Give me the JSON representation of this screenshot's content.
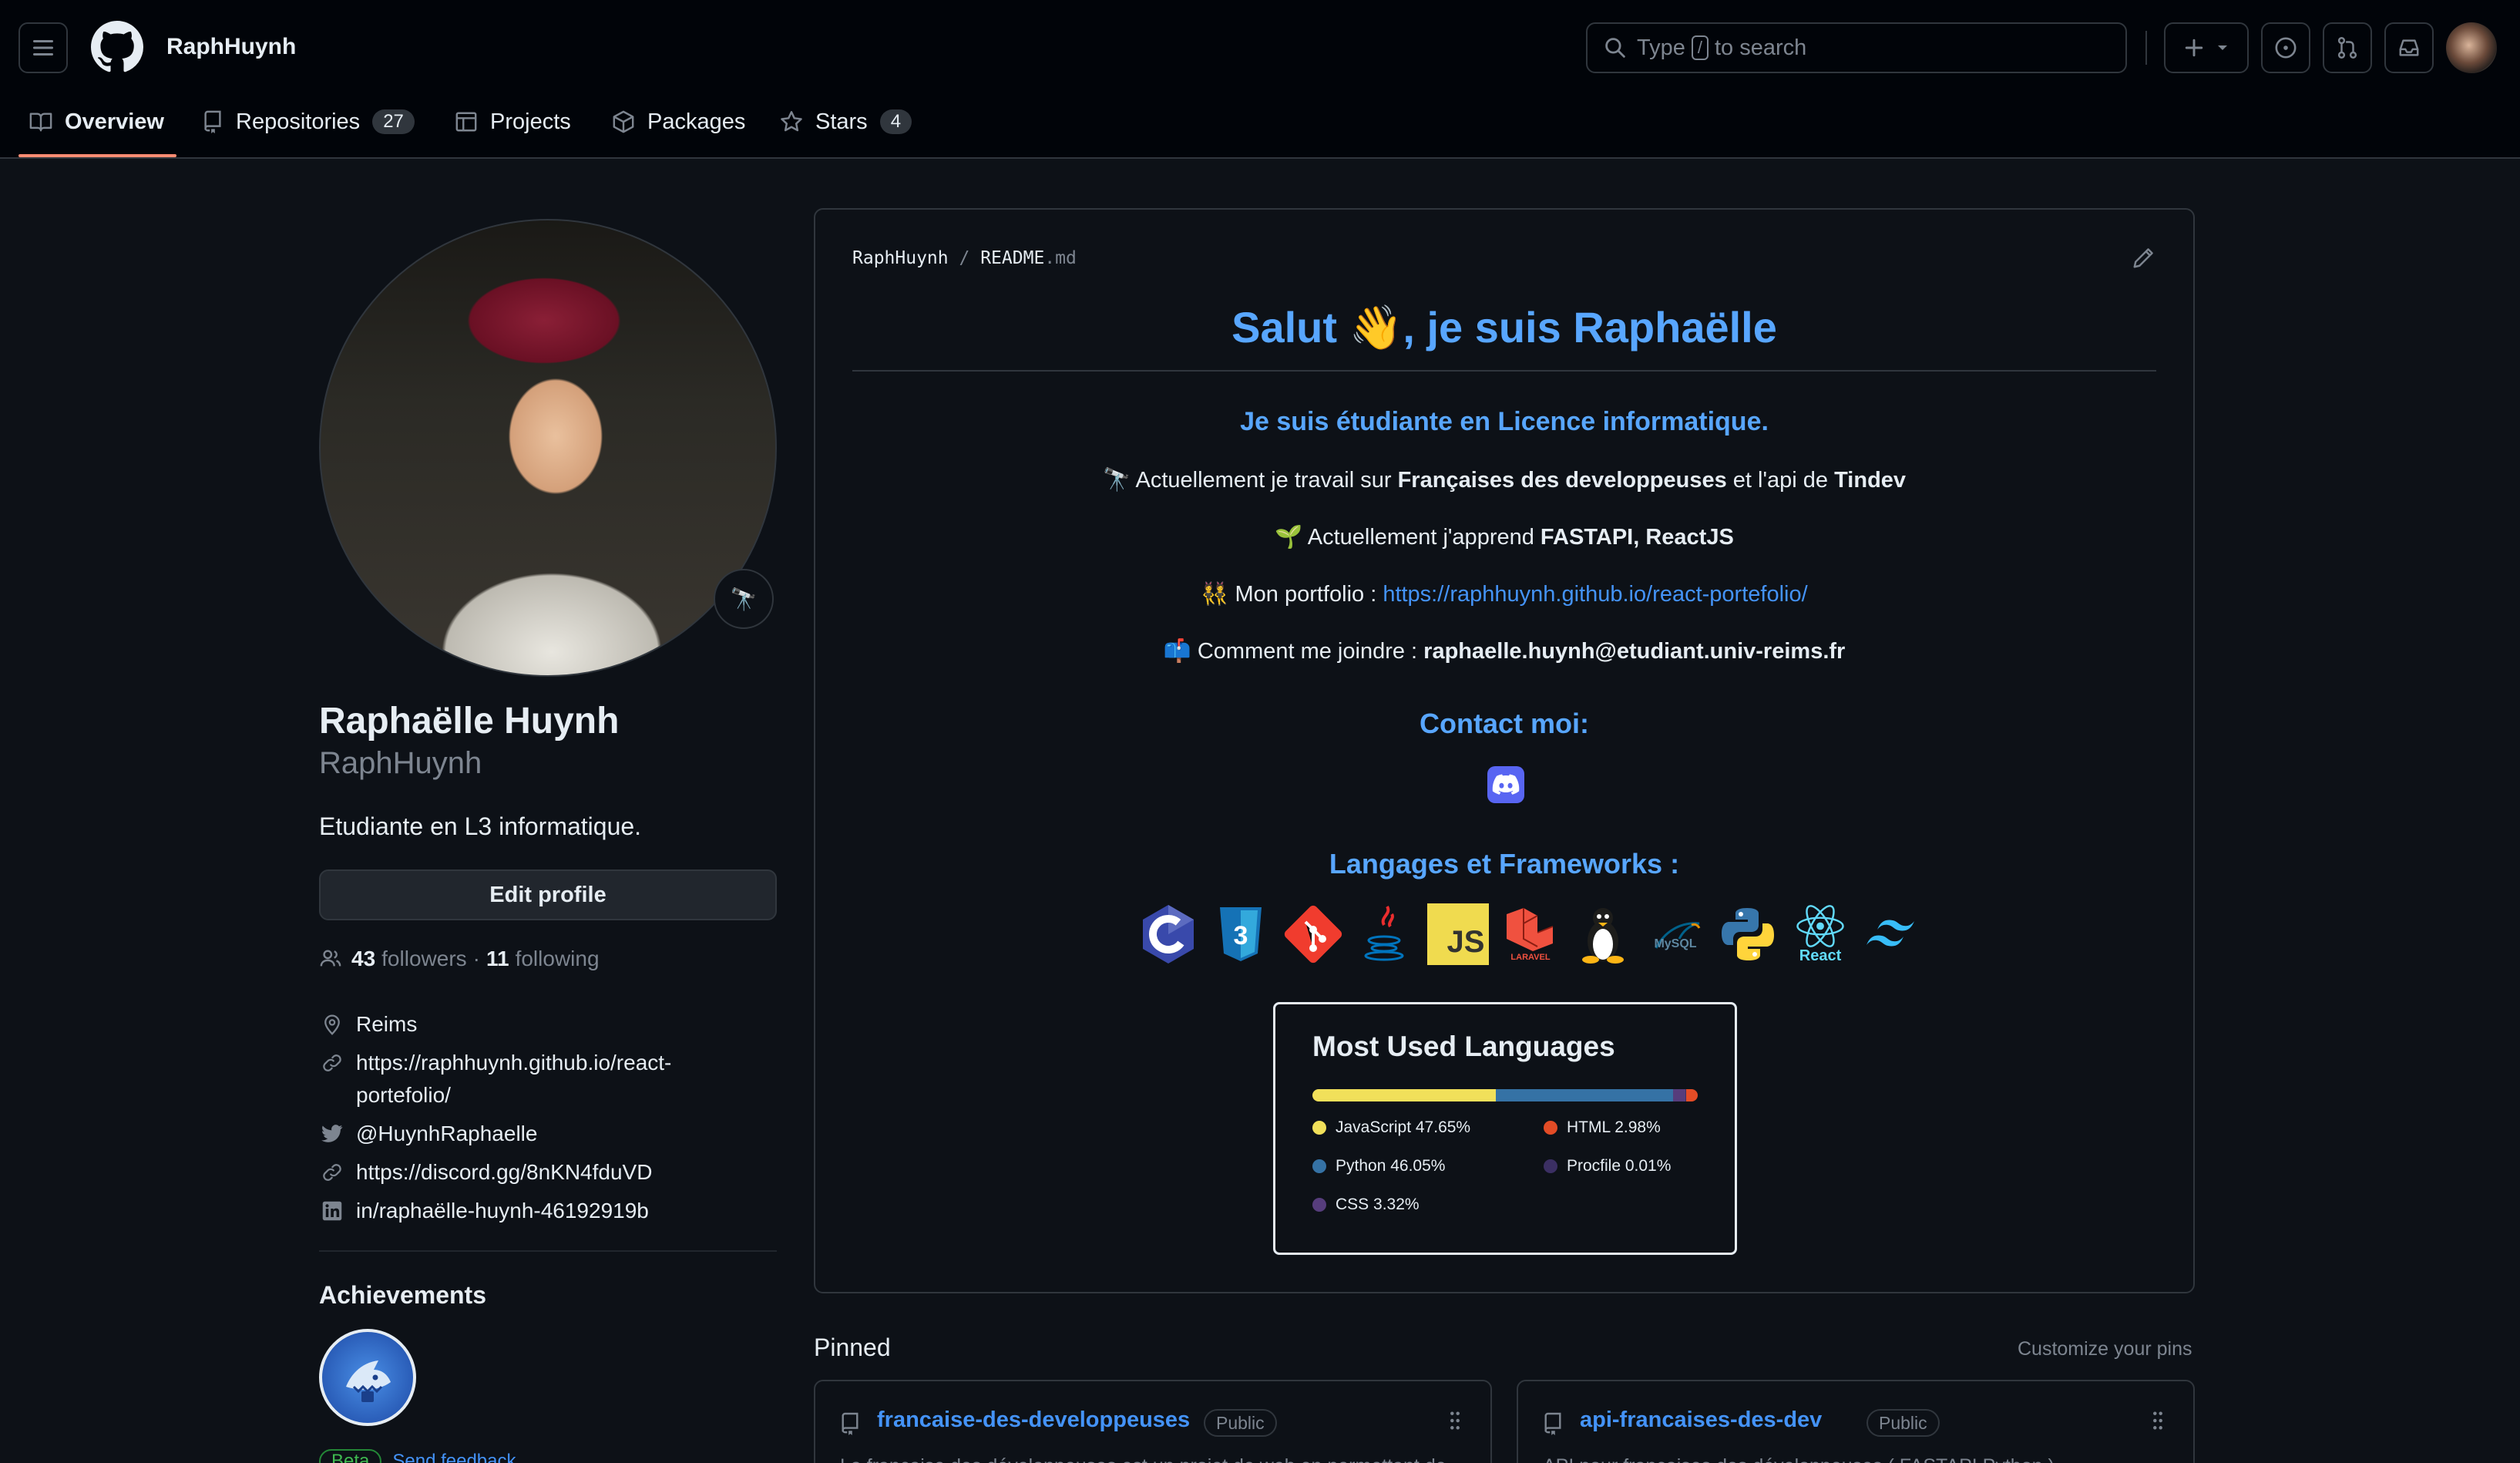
{
  "header": {
    "username": "RaphHuynh",
    "search_prefix": "Type",
    "search_key": "/",
    "search_suffix": "to search"
  },
  "tabs": [
    {
      "label": "Overview"
    },
    {
      "label": "Repositories",
      "count": "27"
    },
    {
      "label": "Projects"
    },
    {
      "label": "Packages"
    },
    {
      "label": "Stars",
      "count": "4"
    }
  ],
  "profile": {
    "full_name": "Raphaëlle Huynh",
    "login": "RaphHuynh",
    "bio": "Etudiante en L3 informatique.",
    "edit_label": "Edit profile",
    "followers_count": "43",
    "followers_label": "followers",
    "separator": "·",
    "following_count": "11",
    "following_label": "following",
    "location": "Reims",
    "website_line1": "https://raphhuynh.github.io/react-",
    "website_line2": "portefolio/",
    "twitter": "@HuynhRaphaelle",
    "discord": "https://discord.gg/8nKN4fduVD",
    "linkedin": "in/raphaëlle-huynh-46192919b"
  },
  "achievements": {
    "title": "Achievements",
    "beta_label": "Beta",
    "feedback_label": "Send feedback"
  },
  "readme": {
    "path_user": "RaphHuynh",
    "path_sep": "/",
    "path_file": "README",
    "path_ext": ".md",
    "heading": "Salut 👋, je suis Raphaëlle",
    "subheading": "Je suis étudiante en Licence informatique.",
    "line1_pre": "🔭 Actuellement je travail sur ",
    "line1_bold1": "Françaises des developpeuses",
    "line1_mid": " et l'api de ",
    "line1_bold2": "Tindev",
    "line2_pre": "🌱 Actuellement j'apprend ",
    "line2_bold": "FASTAPI, ReactJS",
    "line3_pre": "👯 Mon portfolio : ",
    "line3_link": "https://raphhuynh.github.io/react-portefolio/",
    "line4_pre": "📫 Comment me joindre : ",
    "line4_bold": "raphaelle.huynh@etudiant.univ-reims.fr",
    "contact_heading": "Contact moi:",
    "frameworks_heading": "Langages et Frameworks :",
    "tech_icons": [
      "c-icon",
      "css3-icon",
      "git-icon",
      "java-icon",
      "javascript-icon",
      "laravel-icon",
      "linux-icon",
      "mysql-icon",
      "python-icon",
      "react-icon",
      "tailwind-icon"
    ],
    "js_text": "JS",
    "laravel_text": "LARAVEL",
    "mysql_text": "MySQL",
    "react_text": "React"
  },
  "languages": {
    "title": "Most Used Languages",
    "items": [
      {
        "label": "JavaScript 47.65%",
        "color": "#f1e05a",
        "pct": 47.65
      },
      {
        "label": "HTML 2.98%",
        "color": "#e34c26",
        "pct": 2.98
      },
      {
        "label": "Python 46.05%",
        "color": "#3572a5",
        "pct": 46.05
      },
      {
        "label": "Procfile 0.01%",
        "color": "#3b2f63",
        "pct": 0.01
      },
      {
        "label": "CSS 3.32%",
        "color": "#563d7c",
        "pct": 3.32
      }
    ]
  },
  "pinned": {
    "title": "Pinned",
    "customize": "Customize your pins",
    "repos": [
      {
        "name": "francaise-des-developpeuses",
        "visibility": "Public",
        "desc": "La francaise des développeuses est un projet de web en permettant de"
      },
      {
        "name": "api-francaises-des-dev",
        "visibility": "Public",
        "desc": "API pour francaises des développeuses ( FASTAPI Python )"
      }
    ]
  },
  "colors": {
    "accent": "#4493f8",
    "heading": "#58a6ff",
    "tab_underline": "#fd8c73"
  }
}
